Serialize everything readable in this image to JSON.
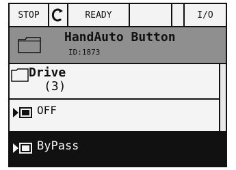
{
  "status": {
    "stop": "STOP",
    "ref_icon": "rotate-c-icon",
    "ready": "READY",
    "io": "I/O"
  },
  "header": {
    "title": "HandAuto Button",
    "id": "ID:1873",
    "icon": "folder-icon"
  },
  "menu": {
    "items": [
      {
        "label": "Drive",
        "count": "(3)",
        "icon": "folder-icon"
      },
      {
        "label": "OFF",
        "icon": "parameter-icon"
      },
      {
        "label": "ByPass",
        "icon": "parameter-icon",
        "selected": true
      }
    ]
  },
  "colors": {
    "background": "#111111",
    "panel": "#f4f4f4",
    "header": "#8f8f8f"
  }
}
